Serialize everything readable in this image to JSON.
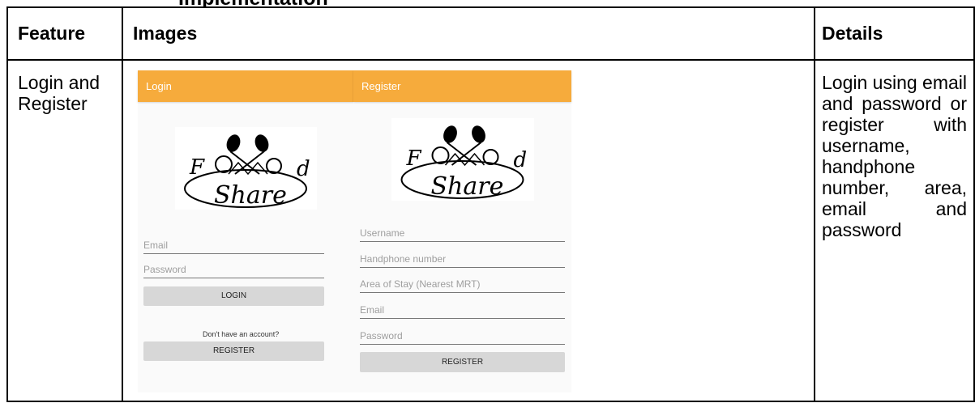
{
  "top_heading_fragment": "Implementation",
  "table": {
    "headers": {
      "feature": "Feature",
      "images": "Images",
      "details": "Details"
    },
    "row": {
      "feature": "Login and Register",
      "details": "Login using email and password or register with username, handphone number, area, email and password"
    }
  },
  "login_screen": {
    "title": "Login",
    "email_placeholder": "Email",
    "password_placeholder": "Password",
    "login_button": "LOGIN",
    "no_account_text": "Don't have an account?",
    "register_button": "REGISTER"
  },
  "register_screen": {
    "title": "Register",
    "username_placeholder": "Username",
    "phone_placeholder": "Handphone number",
    "area_placeholder": "Area of Stay (Nearest MRT)",
    "email_placeholder": "Email",
    "password_placeholder": "Password",
    "register_button": "REGISTER"
  },
  "logo": {
    "text_top_left": "F",
    "text_top_right": "d",
    "text_bottom": "Share"
  },
  "colors": {
    "appbar": "#f6ab3c",
    "button": "#d7d7d7"
  }
}
